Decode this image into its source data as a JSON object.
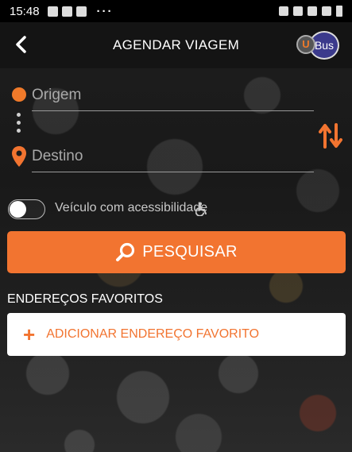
{
  "status_bar": {
    "time": "15:48",
    "overflow": "···"
  },
  "app_bar": {
    "title": "AGENDAR VIAGEM",
    "back_icon": "back-arrow-icon",
    "logo": {
      "prefix": "U",
      "text": "Bus"
    }
  },
  "route": {
    "origin_placeholder": "Origem",
    "destination_placeholder": "Destino",
    "origin_value": "",
    "destination_value": ""
  },
  "accessibility": {
    "label": "Veículo com acessibilidade",
    "enabled": false
  },
  "search": {
    "label": "PESQUISAR"
  },
  "favorites": {
    "heading": "ENDEREÇOS FAVORITOS",
    "add_plus": "+",
    "add_label": "ADICIONAR ENDEREÇO FAVORITO"
  },
  "colors": {
    "accent": "#f27430",
    "background": "#141414",
    "card": "#ffffff"
  }
}
